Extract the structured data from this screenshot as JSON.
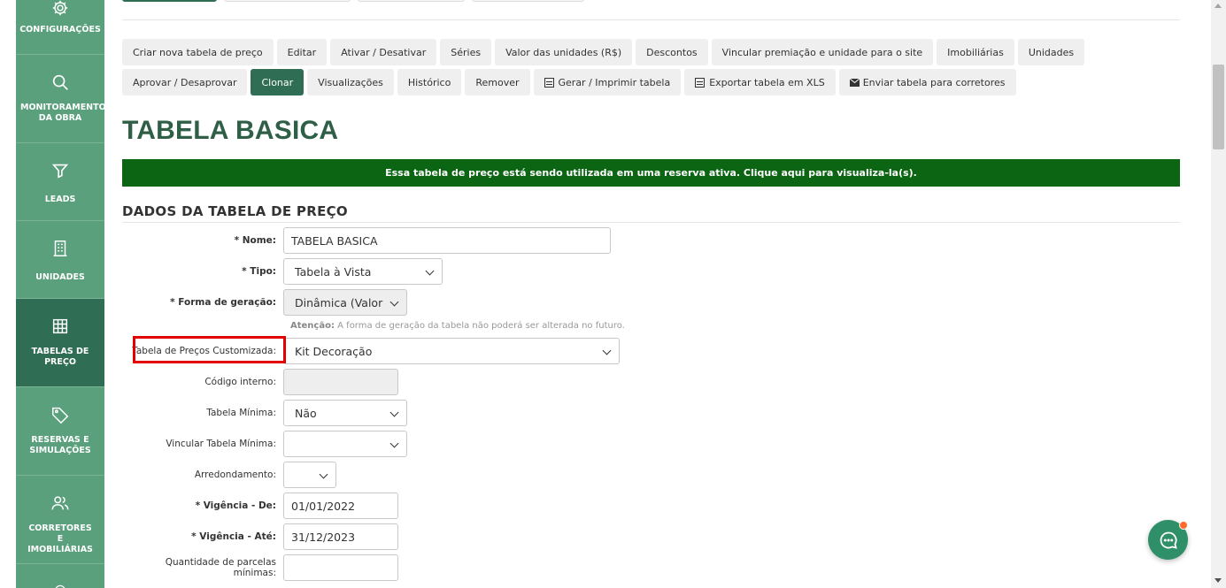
{
  "sidebar": {
    "items": [
      {
        "label": "CONFIGURAÇÕES",
        "icon": "gear-icon"
      },
      {
        "label": "MONITORAMENTO DA OBRA",
        "icon": "search-icon"
      },
      {
        "label": "LEADS",
        "icon": "filter-icon"
      },
      {
        "label": "UNIDADES",
        "icon": "building-icon"
      },
      {
        "label": "TABELAS DE PREÇO",
        "icon": "grid-icon",
        "active": true
      },
      {
        "label": "RESERVAS E SIMULAÇÕES",
        "icon": "tag-icon"
      },
      {
        "label": "CORRETORES E IMOBILIÁRIAS",
        "icon": "users-icon"
      }
    ]
  },
  "toolbar": {
    "row1": [
      "Criar nova tabela de preço",
      "Editar",
      "Ativar / Desativar",
      "Séries",
      "Valor das unidades (R$)",
      "Descontos",
      "Vincular premiação e unidade para o site",
      "Imobiliárias",
      "Unidades"
    ],
    "row2": [
      "Aprovar / Desaprovar",
      "Clonar",
      "Visualizações",
      "Histórico",
      "Remover",
      "Gerar / Imprimir tabela",
      "Exportar tabela em XLS",
      "Enviar tabela para corretores"
    ],
    "active": "Clonar"
  },
  "page": {
    "title": "TABELA BASICA",
    "banner": "Essa tabela de preço está sendo utilizada em uma reserva ativa. Clique aqui para visualiza-la(s).",
    "section_title": "DADOS DA TABELA DE PREÇO"
  },
  "form": {
    "nome": {
      "label": "* Nome:",
      "value": "TABELA BASICA"
    },
    "tipo": {
      "label": "* Tipo:",
      "value": "Tabela à Vista"
    },
    "forma": {
      "label": "* Forma de geração:",
      "value": "Dinâmica (Valor"
    },
    "hint_bold": "Atenção:",
    "hint_text": " A forma de geração da tabela não poderá ser alterada no futuro.",
    "customizada": {
      "label": "Tabela de Preços Customizada:",
      "value": "Kit Decoração"
    },
    "codigo": {
      "label": "Código interno:",
      "value": ""
    },
    "minima": {
      "label": "Tabela Mínima:",
      "value": "Não"
    },
    "vincular": {
      "label": "Vincular Tabela Mínima:",
      "value": ""
    },
    "arred": {
      "label": "Arredondamento:",
      "value": ""
    },
    "vig_de": {
      "label": "* Vigência - De:",
      "value": "01/01/2022"
    },
    "vig_ate": {
      "label": "* Vigência - Até:",
      "value": "31/12/2023"
    },
    "parcelas": {
      "label": "Quantidade de parcelas mínimas:",
      "value": ""
    }
  },
  "colors": {
    "sidebar": "#5aa07c",
    "sidebar_active": "#2f6e55",
    "banner": "#0b6513",
    "highlight": "#e30000",
    "chat": "#2f8f68"
  }
}
